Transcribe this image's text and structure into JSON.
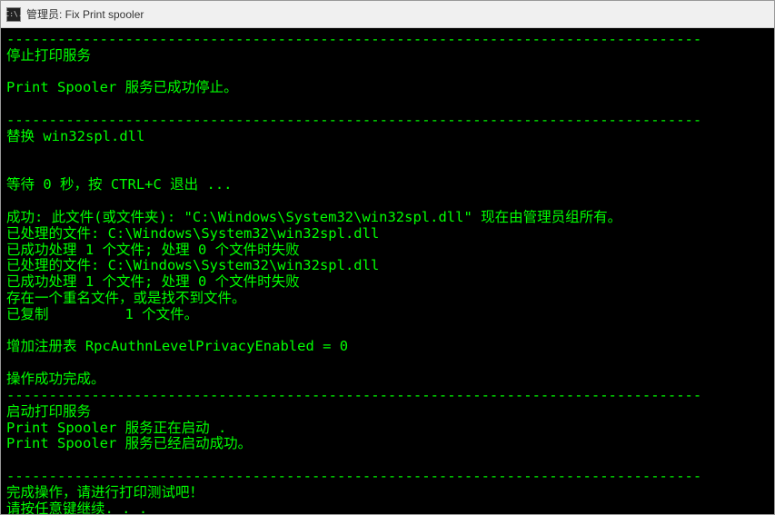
{
  "window": {
    "icon_label": "C:\\.",
    "title": "管理员:  Fix Print spooler"
  },
  "terminal": {
    "separator": "----------------------------------------------------------------------------------",
    "lines": [
      "sep",
      "停止打印服务",
      "",
      "Print Spooler 服务已成功停止。",
      "",
      "sep",
      "替换 win32spl.dll",
      "",
      "",
      "等待 0 秒，按 CTRL+C 退出 ...",
      "",
      "成功: 此文件(或文件夹): \"C:\\Windows\\System32\\win32spl.dll\" 现在由管理员组所有。",
      "已处理的文件: C:\\Windows\\System32\\win32spl.dll",
      "已成功处理 1 个文件; 处理 0 个文件时失败",
      "已处理的文件: C:\\Windows\\System32\\win32spl.dll",
      "已成功处理 1 个文件; 处理 0 个文件时失败",
      "存在一个重名文件，或是找不到文件。",
      "已复制         1 个文件。",
      "",
      "增加注册表 RpcAuthnLevelPrivacyEnabled = 0",
      "",
      "操作成功完成。",
      "sep",
      "启动打印服务",
      "Print Spooler 服务正在启动 .",
      "Print Spooler 服务已经启动成功。",
      "",
      "sep",
      "完成操作，请进行打印测试吧！",
      "请按任意键继续. . ."
    ]
  }
}
